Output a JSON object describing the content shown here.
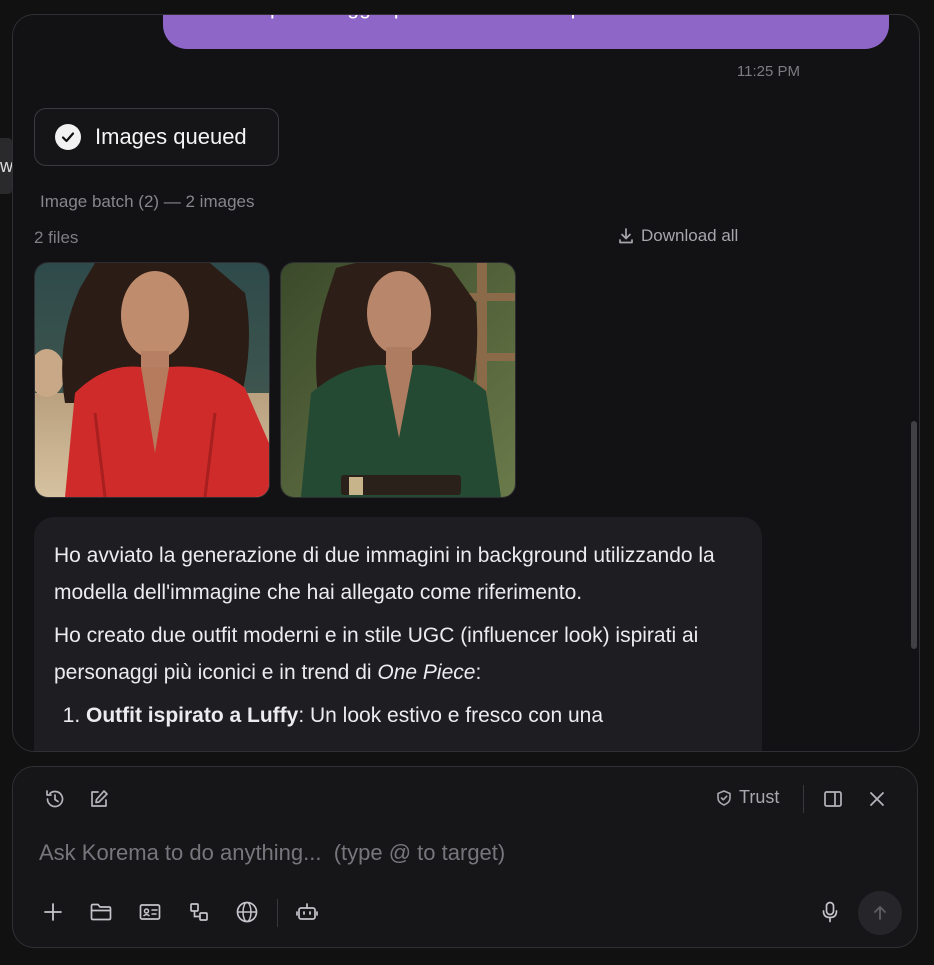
{
  "edge_tab": {
    "label": "w"
  },
  "chat": {
    "user_message_visible": "base del personaggio più in trend di one piece.",
    "timestamp": "11:25 PM",
    "status_pill": {
      "label": "Images queued",
      "icon": "check-circle-icon"
    },
    "batch": {
      "title": "Image batch (2) — 2 images",
      "files_count": "2 files",
      "download_all_label": "Download all",
      "images": [
        {
          "name": "generated-image-red-outfit"
        },
        {
          "name": "generated-image-green-outfit"
        }
      ]
    },
    "assistant": {
      "paragraph_1": "Ho avviato la generazione di due immagini in background utilizzando la modella dell'immagine che hai allegato come riferimento.",
      "paragraph_2_pre": "Ho creato due outfit moderni e in stile UGC (influencer look) ispirati ai personaggi più iconici e in trend di ",
      "paragraph_2_em": "One Piece",
      "paragraph_2_post": ":",
      "list_item_1_bold": "Outfit ispirato a Luffy",
      "list_item_1_rest": ": Un look estivo e fresco con una"
    }
  },
  "composer": {
    "placeholder": "Ask Korema to do anything...  (type @ to target)",
    "trust_label": "Trust",
    "top_icons": [
      "history-icon",
      "edit-icon",
      "shield-icon",
      "sidebar-toggle-icon",
      "close-icon"
    ],
    "bottom_icons": [
      "plus-icon",
      "folder-icon",
      "contact-card-icon",
      "shapes-icon",
      "globe-icon",
      "bot-icon",
      "microphone-icon",
      "send-arrow-icon"
    ]
  },
  "colors": {
    "background": "#111112",
    "user_bubble": "#8e66c8",
    "assistant_bubble": "#1e1e22",
    "panel_border": "#303034"
  }
}
